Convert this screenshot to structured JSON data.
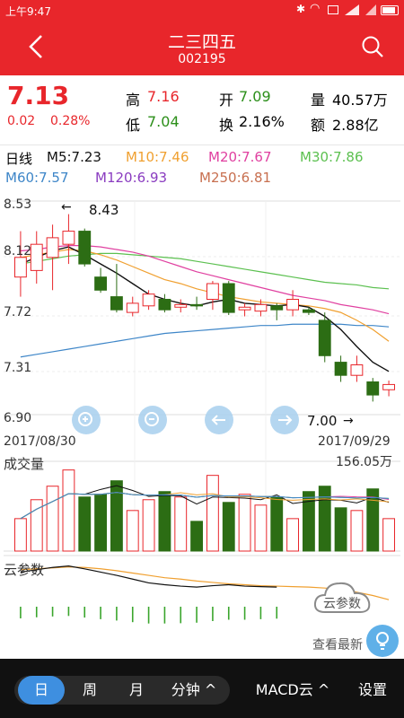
{
  "status_bar": {
    "time": "上午9:47"
  },
  "header": {
    "title": "二三四五",
    "code": "002195"
  },
  "quote": {
    "price": "7.13",
    "change": "0.02",
    "change_pct": "0.28%",
    "high_label": "高",
    "high": "7.16",
    "open_label": "开",
    "open": "7.09",
    "volume_label": "量",
    "volume": "40.57万",
    "low_label": "低",
    "low": "7.04",
    "turnover_label": "换",
    "turnover": "2.16%",
    "amount_label": "额",
    "amount": "2.88亿"
  },
  "ma_legend": {
    "period": "日线",
    "ma5": "M5:7.23",
    "ma10": "M10:7.46",
    "ma20": "M20:7.67",
    "ma30": "M30:7.86",
    "ma60": "M60:7.57",
    "ma120": "M120:6.93",
    "ma250": "M250:6.81"
  },
  "price_panel": {
    "levels": [
      "8.53",
      "8.12",
      "7.72",
      "7.31",
      "6.90"
    ],
    "high_mark": "8.43",
    "low_mark": "7.00",
    "start_date": "2017/08/30",
    "end_date": "2017/09/29"
  },
  "volume_panel": {
    "title": "成交量",
    "max": "156.05万"
  },
  "indicator_panel": {
    "title": "云参数",
    "cloud_badge": "云参数",
    "cloud_link": "查看最新"
  },
  "bottom_bar": {
    "tabs": [
      "日",
      "周",
      "月",
      "分钟 ^"
    ],
    "active": "日",
    "indicator": "MACD云 ^",
    "settings": "设置"
  },
  "colors": {
    "up": "#e8262b",
    "down": "#2c6d14",
    "ma5": "#111111",
    "ma10": "#f0a030",
    "ma20": "#e040a0",
    "ma30": "#5cc050",
    "ma60": "#3e86c8",
    "ma120": "#8a3cc0",
    "ma250": "#c87050"
  },
  "chart_data": {
    "type": "candlestick",
    "dates": [
      "2017/08/30",
      "2017/09/29"
    ],
    "candles": [
      {
        "o": 7.95,
        "h": 8.3,
        "l": 7.8,
        "c": 8.1
      },
      {
        "o": 8.0,
        "h": 8.3,
        "l": 7.9,
        "c": 8.2
      },
      {
        "o": 8.1,
        "h": 8.35,
        "l": 7.85,
        "c": 8.25
      },
      {
        "o": 8.2,
        "h": 8.43,
        "l": 8.05,
        "c": 8.3
      },
      {
        "o": 8.3,
        "h": 8.32,
        "l": 8.03,
        "c": 8.05
      },
      {
        "o": 7.95,
        "h": 8.02,
        "l": 7.83,
        "c": 7.85
      },
      {
        "o": 7.8,
        "h": 8.05,
        "l": 7.68,
        "c": 7.7
      },
      {
        "o": 7.68,
        "h": 7.8,
        "l": 7.65,
        "c": 7.75
      },
      {
        "o": 7.73,
        "h": 7.85,
        "l": 7.7,
        "c": 7.82
      },
      {
        "o": 7.78,
        "h": 7.82,
        "l": 7.68,
        "c": 7.7
      },
      {
        "o": 7.72,
        "h": 7.78,
        "l": 7.68,
        "c": 7.74
      },
      {
        "o": 7.74,
        "h": 7.8,
        "l": 7.7,
        "c": 7.73
      },
      {
        "o": 7.78,
        "h": 7.92,
        "l": 7.7,
        "c": 7.9
      },
      {
        "o": 7.9,
        "h": 7.92,
        "l": 7.66,
        "c": 7.68
      },
      {
        "o": 7.7,
        "h": 7.75,
        "l": 7.65,
        "c": 7.72
      },
      {
        "o": 7.69,
        "h": 7.78,
        "l": 7.65,
        "c": 7.74
      },
      {
        "o": 7.73,
        "h": 7.75,
        "l": 7.62,
        "c": 7.7
      },
      {
        "o": 7.7,
        "h": 7.85,
        "l": 7.65,
        "c": 7.78
      },
      {
        "o": 7.7,
        "h": 7.72,
        "l": 7.66,
        "c": 7.68
      },
      {
        "o": 7.62,
        "h": 7.68,
        "l": 7.3,
        "c": 7.35
      },
      {
        "o": 7.3,
        "h": 7.35,
        "l": 7.15,
        "c": 7.2
      },
      {
        "o": 7.2,
        "h": 7.35,
        "l": 7.15,
        "c": 7.28
      },
      {
        "o": 7.15,
        "h": 7.18,
        "l": 7.0,
        "c": 7.05
      },
      {
        "o": 7.09,
        "h": 7.16,
        "l": 7.04,
        "c": 7.13
      }
    ],
    "ma5": [
      8.05,
      8.1,
      8.15,
      8.18,
      8.12,
      8.05,
      7.98,
      7.9,
      7.82,
      7.78,
      7.75,
      7.73,
      7.76,
      7.78,
      7.75,
      7.74,
      7.73,
      7.74,
      7.72,
      7.65,
      7.55,
      7.42,
      7.3,
      7.23
    ],
    "ma10": [
      8.1,
      8.12,
      8.14,
      8.16,
      8.15,
      8.12,
      8.08,
      8.03,
      7.98,
      7.93,
      7.9,
      7.86,
      7.83,
      7.8,
      7.78,
      7.76,
      7.75,
      7.74,
      7.73,
      7.71,
      7.68,
      7.62,
      7.55,
      7.46
    ],
    "ma20": [
      8.15,
      8.16,
      8.18,
      8.19,
      8.19,
      8.18,
      8.16,
      8.14,
      8.11,
      8.07,
      8.03,
      7.99,
      7.96,
      7.93,
      7.9,
      7.87,
      7.84,
      7.81,
      7.79,
      7.77,
      7.74,
      7.72,
      7.7,
      7.67
    ],
    "ma30": [
      8.05,
      8.07,
      8.09,
      8.11,
      8.12,
      8.13,
      8.13,
      8.12,
      8.11,
      8.1,
      8.09,
      8.07,
      8.05,
      8.03,
      8.01,
      7.99,
      7.97,
      7.95,
      7.93,
      7.91,
      7.9,
      7.89,
      7.87,
      7.86
    ],
    "ma60": [
      7.34,
      7.36,
      7.38,
      7.4,
      7.42,
      7.44,
      7.46,
      7.48,
      7.5,
      7.52,
      7.53,
      7.54,
      7.55,
      7.56,
      7.57,
      7.58,
      7.58,
      7.59,
      7.59,
      7.59,
      7.59,
      7.58,
      7.58,
      7.57
    ],
    "volume": [
      60,
      95,
      120,
      150,
      100,
      105,
      130,
      75,
      95,
      110,
      100,
      55,
      140,
      90,
      105,
      85,
      100,
      60,
      110,
      120,
      80,
      75,
      115,
      60
    ],
    "volume_max": 156.05,
    "y_range": [
      6.9,
      8.53
    ]
  }
}
